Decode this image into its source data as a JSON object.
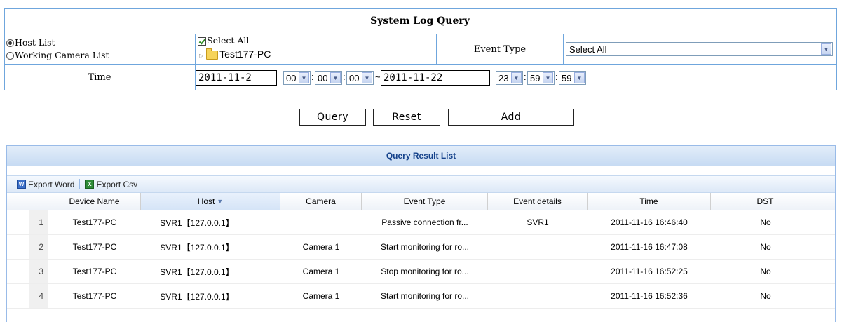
{
  "query_form": {
    "title": "System Log Query",
    "source_options": [
      {
        "label": "Host List",
        "selected": true
      },
      {
        "label": "Working Camera List",
        "selected": false
      }
    ],
    "select_all_label": "Select All",
    "select_all_checked": true,
    "tree_node": "Test177-PC",
    "event_type_label": "Event Type",
    "event_type_value": "Select All",
    "time_label": "Time",
    "start_date": "2011-11-2",
    "start_hour": "00",
    "start_minute": "00",
    "start_second": "00",
    "range_separator": "~",
    "end_date": "2011-11-22",
    "end_hour": "23",
    "end_minute": "59",
    "end_second": "59",
    "time_colon": ":"
  },
  "actions": {
    "query_label": "Query",
    "reset_label": "Reset",
    "add_label": "Add"
  },
  "results": {
    "title": "Query Result List",
    "toolbar": {
      "export_word_label": "Export Word",
      "export_csv_label": "Export Csv"
    },
    "columns": [
      "Device Name",
      "Host",
      "Camera",
      "Event Type",
      "Event details",
      "Time",
      "DST"
    ],
    "rows": [
      {
        "n": "1",
        "device": "Test177-PC",
        "host": "SVR1【127.0.0.1】",
        "camera": "",
        "event_type": "Passive connection fr...",
        "details": "SVR1",
        "time": "2011-11-16 16:46:40",
        "dst": "No"
      },
      {
        "n": "2",
        "device": "Test177-PC",
        "host": "SVR1【127.0.0.1】",
        "camera": "Camera 1",
        "event_type": "Start monitoring for ro...",
        "details": "",
        "time": "2011-11-16 16:47:08",
        "dst": "No"
      },
      {
        "n": "3",
        "device": "Test177-PC",
        "host": "SVR1【127.0.0.1】",
        "camera": "Camera 1",
        "event_type": "Stop monitoring for ro...",
        "details": "",
        "time": "2011-11-16 16:52:25",
        "dst": "No"
      },
      {
        "n": "4",
        "device": "Test177-PC",
        "host": "SVR1【127.0.0.1】",
        "camera": "Camera 1",
        "event_type": "Start monitoring for ro...",
        "details": "",
        "time": "2011-11-16 16:52:36",
        "dst": "No"
      }
    ]
  },
  "colors": {
    "form_border": "#6fa6dd",
    "grid_title_text": "#15428b",
    "grid_border": "#99bbe8"
  },
  "icons": {
    "word": "word-document-icon",
    "excel": "excel-spreadsheet-icon",
    "dropdown": "chevron-down-icon",
    "tree_expand": "tree-expand-arrow-icon",
    "folder": "folder-icon"
  }
}
